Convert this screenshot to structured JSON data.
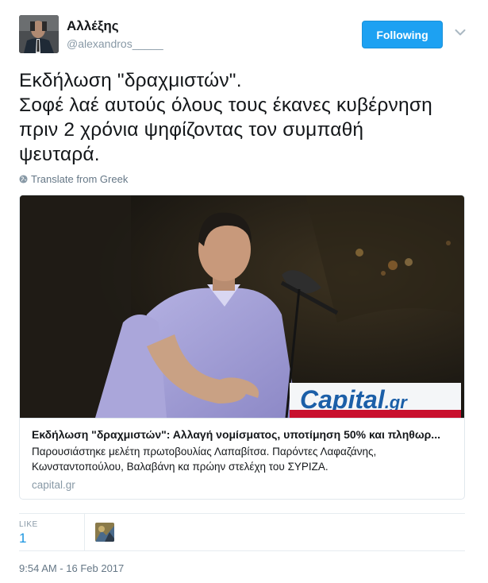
{
  "author": {
    "name": "Αλλέξης",
    "handle": "@alexandros_____"
  },
  "follow_button_label": "Following",
  "tweet_text_lines": [
    "Εκδήλωση \"δραχμιστών\".",
    "Σοφέ λαέ αυτούς όλους τους έκανες κυβέρνηση",
    "πριν 2 χρόνια ψηφίζοντας τον συμπαθή",
    "ψευταρά."
  ],
  "translate_label": "Translate from Greek",
  "card": {
    "image_logo_text": "Capital",
    "image_logo_suffix": ".gr",
    "title": "Εκδήλωση \"δραχμιστών\": Αλλαγή νομίσματος, υποτίμηση 50% και πληθωρ...",
    "description_lines": [
      "Παρουσιάστηκε μελέτη πρωτοβουλίας Λαπαβίτσα. Παρόντες Λαφαζάνης,",
      "Κωνσταντοπούλου, Βαλαβάνη κα πρώην στελέχη του ΣΥΡΙΖΑ."
    ],
    "domain": "capital.gr"
  },
  "stats": {
    "likes_label": "LIKE",
    "likes_count": "1"
  },
  "timestamp": "9:54 AM - 16 Feb 2017",
  "icons": {
    "menu": "chevron-down-icon",
    "translate": "globe-icon"
  },
  "colors": {
    "accent": "#1da1f2",
    "link": "#1b95e0",
    "muted": "#8899a6"
  }
}
